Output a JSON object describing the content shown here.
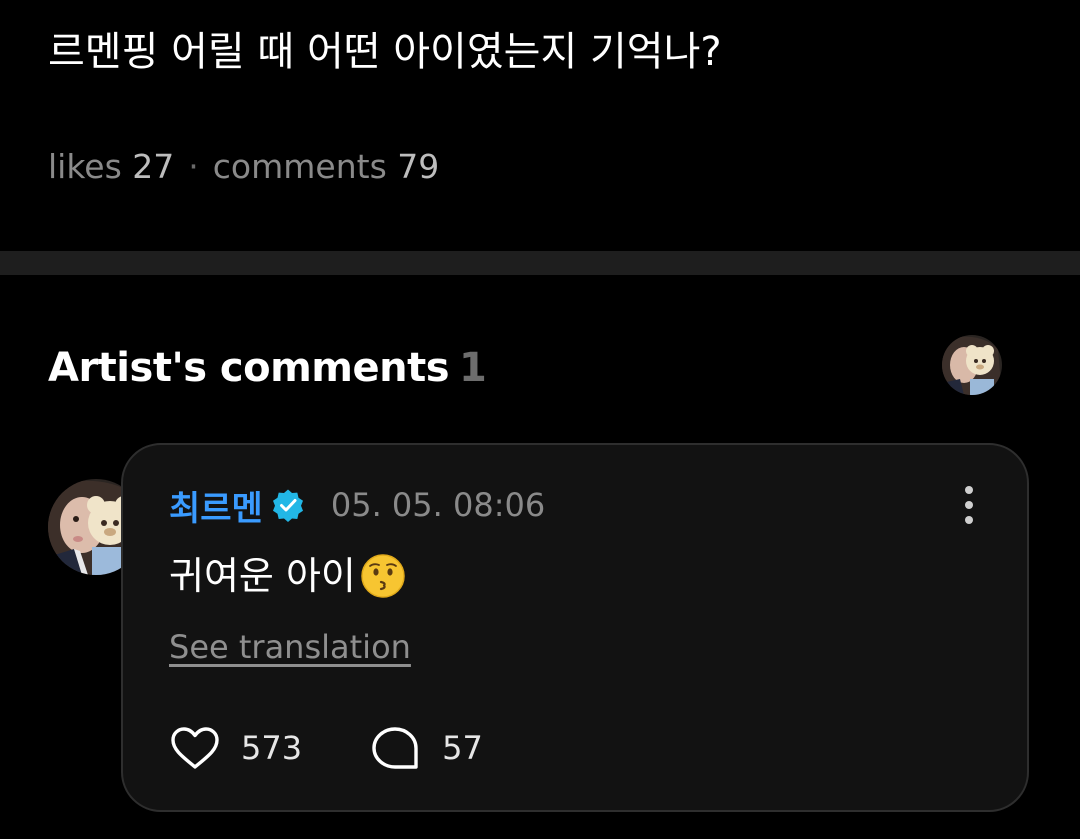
{
  "post": {
    "title": "르멘핑 어릴 때 어떤 아이였는지 기억나?",
    "likes_label": "likes",
    "likes_count": "27",
    "separator": "·",
    "comments_label": "comments",
    "comments_count": "79"
  },
  "artist_comments": {
    "heading": "Artist's comments",
    "count": "1"
  },
  "comment": {
    "author": "최르멘",
    "verified": true,
    "timestamp": "05. 05. 08:06",
    "text": "귀여운 아이",
    "emoji": "kissing-face",
    "see_translation": "See translation",
    "like_count": "573",
    "reply_count": "57"
  },
  "colors": {
    "background": "#000000",
    "card_background": "#121212",
    "author_blue": "#3a9bff",
    "verified_badge": "#22b7e6",
    "divider": "#1e1e1e",
    "muted_text": "#8a8a8a"
  },
  "icons": {
    "verified": "verified-badge-icon",
    "more": "vertical-dots-icon",
    "like": "heart-outline-icon",
    "reply": "speech-bubble-outline-icon"
  }
}
